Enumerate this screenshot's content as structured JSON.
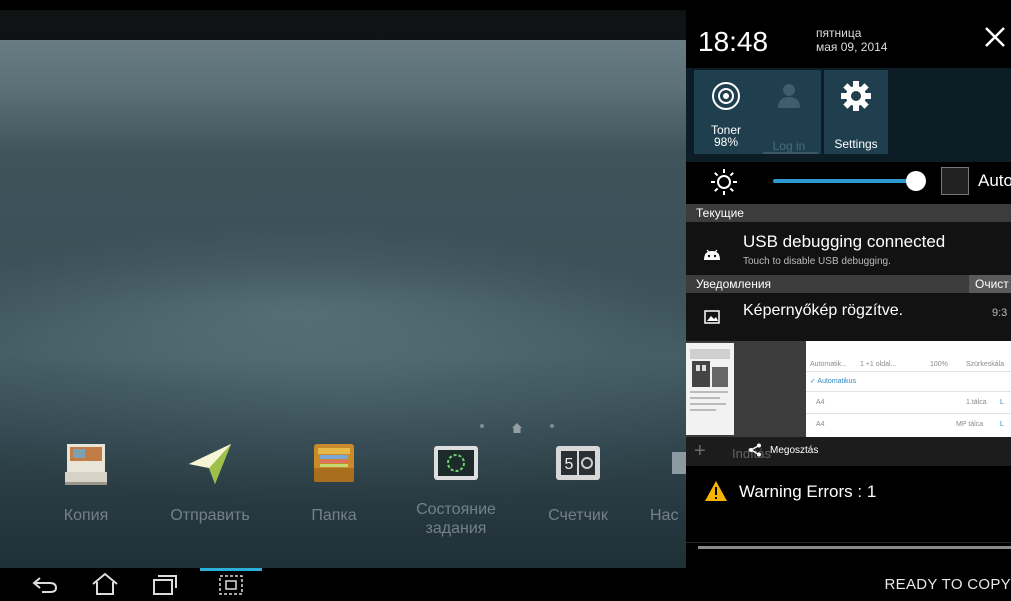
{
  "home": {
    "apps": [
      {
        "label": "Копия"
      },
      {
        "label": "Отправить"
      },
      {
        "label": "Папка"
      },
      {
        "label": "Состояние задания"
      },
      {
        "label": "Счетчик"
      },
      {
        "label": "Нас"
      }
    ],
    "counter_icon_digits": "5"
  },
  "status_bar": {
    "ready_text": "READY TO COPY"
  },
  "panel": {
    "time": "18:48",
    "day": "пятница",
    "date": "мая 09, 2014",
    "quick_settings": [
      {
        "label": "Toner",
        "sublabel": "98%",
        "icon": "toner-icon"
      },
      {
        "label": "Log in",
        "icon": "user-icon"
      },
      {
        "label": "Settings",
        "icon": "gear-icon"
      }
    ],
    "brightness": {
      "level": 0.95,
      "auto_label": "Auto"
    },
    "ongoing_header": "Текущие",
    "usb": {
      "title": "USB debugging connected",
      "subtitle": "Touch to disable USB debugging."
    },
    "notifications_header": "Уведомления",
    "clear_label": "Очист",
    "screenshot": {
      "title": "Képernyőkép rögzítve.",
      "time": "9:3"
    },
    "preview": {
      "header_cells": [
        "Automatik...",
        "1 +1 oldal...",
        "100%",
        "Szürkeskála"
      ],
      "auto_label": "✓ Automatikus",
      "rows": [
        {
          "size": "A4",
          "tray": "1.tálca",
          "col": "L"
        },
        {
          "size": "A4",
          "tray": "MP tálca",
          "col": "L"
        }
      ],
      "share_label": "Megosztás",
      "ghost_label": "Indítás"
    },
    "warning": {
      "text": "Warning Errors : 1",
      "color": "#f5b400"
    }
  },
  "colors": {
    "accent": "#2ab0d8",
    "slider": "#2f9ad1",
    "quick_tile": "#1f3f4e"
  }
}
